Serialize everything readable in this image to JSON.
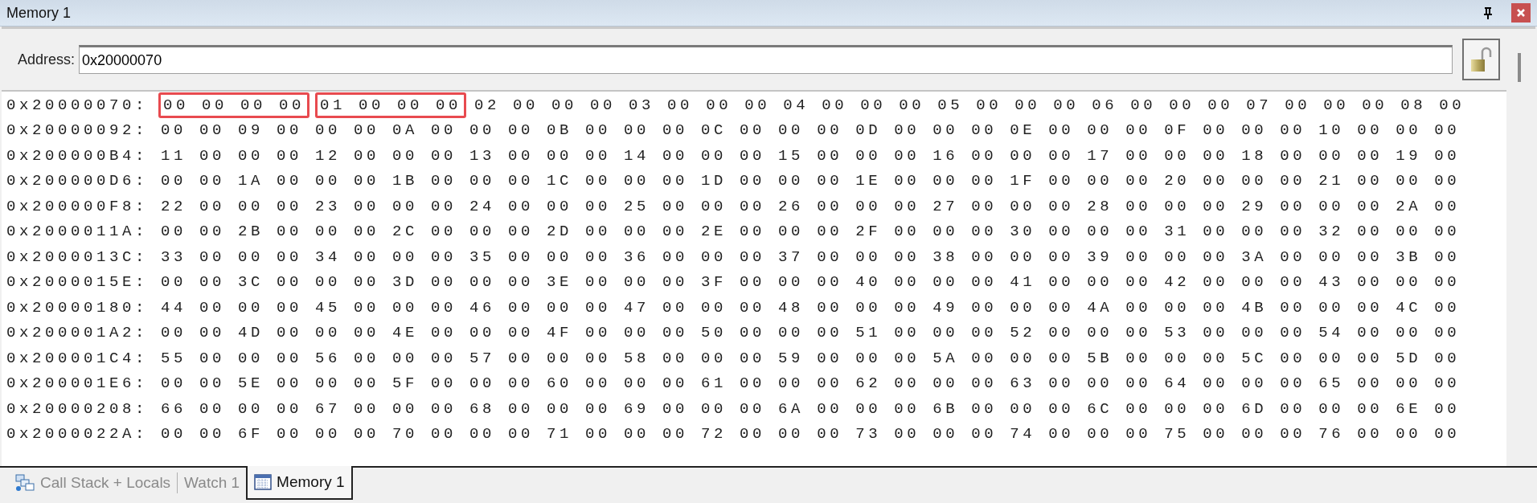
{
  "window": {
    "title": "Memory 1"
  },
  "address": {
    "label": "Address:",
    "value": "0x20000070"
  },
  "rows": [
    {
      "address": "0x20000070:",
      "segments": [
        {
          "bytes": "00 00 00 00",
          "highlighted": true
        },
        {
          "bytes": "01 00 00 00",
          "highlighted": true
        },
        {
          "bytes": "02 00 00 00 03 00 00 00 04 00 00 00 05 00 00 00 06 00 00 00 07 00 00 00 08 00",
          "highlighted": false
        }
      ]
    },
    {
      "address": "0x20000092:",
      "segments": [
        {
          "bytes": "00 00 09 00 00 00 0A 00 00 00 0B 00 00 00 0C 00 00 00 0D 00 00 00 0E 00 00 00 0F 00 00 00 10 00 00 00",
          "highlighted": false
        }
      ]
    },
    {
      "address": "0x200000B4:",
      "segments": [
        {
          "bytes": "11 00 00 00 12 00 00 00 13 00 00 00 14 00 00 00 15 00 00 00 16 00 00 00 17 00 00 00 18 00 00 00 19 00",
          "highlighted": false
        }
      ]
    },
    {
      "address": "0x200000D6:",
      "segments": [
        {
          "bytes": "00 00 1A 00 00 00 1B 00 00 00 1C 00 00 00 1D 00 00 00 1E 00 00 00 1F 00 00 00 20 00 00 00 21 00 00 00",
          "highlighted": false
        }
      ]
    },
    {
      "address": "0x200000F8:",
      "segments": [
        {
          "bytes": "22 00 00 00 23 00 00 00 24 00 00 00 25 00 00 00 26 00 00 00 27 00 00 00 28 00 00 00 29 00 00 00 2A 00",
          "highlighted": false
        }
      ]
    },
    {
      "address": "0x2000011A:",
      "segments": [
        {
          "bytes": "00 00 2B 00 00 00 2C 00 00 00 2D 00 00 00 2E 00 00 00 2F 00 00 00 30 00 00 00 31 00 00 00 32 00 00 00",
          "highlighted": false
        }
      ]
    },
    {
      "address": "0x2000013C:",
      "segments": [
        {
          "bytes": "33 00 00 00 34 00 00 00 35 00 00 00 36 00 00 00 37 00 00 00 38 00 00 00 39 00 00 00 3A 00 00 00 3B 00",
          "highlighted": false
        }
      ]
    },
    {
      "address": "0x2000015E:",
      "segments": [
        {
          "bytes": "00 00 3C 00 00 00 3D 00 00 00 3E 00 00 00 3F 00 00 00 40 00 00 00 41 00 00 00 42 00 00 00 43 00 00 00",
          "highlighted": false
        }
      ]
    },
    {
      "address": "0x20000180:",
      "segments": [
        {
          "bytes": "44 00 00 00 45 00 00 00 46 00 00 00 47 00 00 00 48 00 00 00 49 00 00 00 4A 00 00 00 4B 00 00 00 4C 00",
          "highlighted": false
        }
      ]
    },
    {
      "address": "0x200001A2:",
      "segments": [
        {
          "bytes": "00 00 4D 00 00 00 4E 00 00 00 4F 00 00 00 50 00 00 00 51 00 00 00 52 00 00 00 53 00 00 00 54 00 00 00",
          "highlighted": false
        }
      ]
    },
    {
      "address": "0x200001C4:",
      "segments": [
        {
          "bytes": "55 00 00 00 56 00 00 00 57 00 00 00 58 00 00 00 59 00 00 00 5A 00 00 00 5B 00 00 00 5C 00 00 00 5D 00",
          "highlighted": false
        }
      ]
    },
    {
      "address": "0x200001E6:",
      "segments": [
        {
          "bytes": "00 00 5E 00 00 00 5F 00 00 00 60 00 00 00 61 00 00 00 62 00 00 00 63 00 00 00 64 00 00 00 65 00 00 00",
          "highlighted": false
        }
      ]
    },
    {
      "address": "0x20000208:",
      "segments": [
        {
          "bytes": "66 00 00 00 67 00 00 00 68 00 00 00 69 00 00 00 6A 00 00 00 6B 00 00 00 6C 00 00 00 6D 00 00 00 6E 00",
          "highlighted": false
        }
      ]
    },
    {
      "address": "0x2000022A:",
      "segments": [
        {
          "bytes": "00 00 6F 00 00 00 70 00 00 00 71 00 00 00 72 00 00 00 73 00 00 00 74 00 00 00 75 00 00 00 76 00 00 00",
          "highlighted": false
        }
      ]
    }
  ],
  "tabs": [
    {
      "label": "Call Stack + Locals",
      "selected": false
    },
    {
      "label": "Watch 1",
      "selected": false
    },
    {
      "label": "Memory 1",
      "selected": true
    }
  ]
}
